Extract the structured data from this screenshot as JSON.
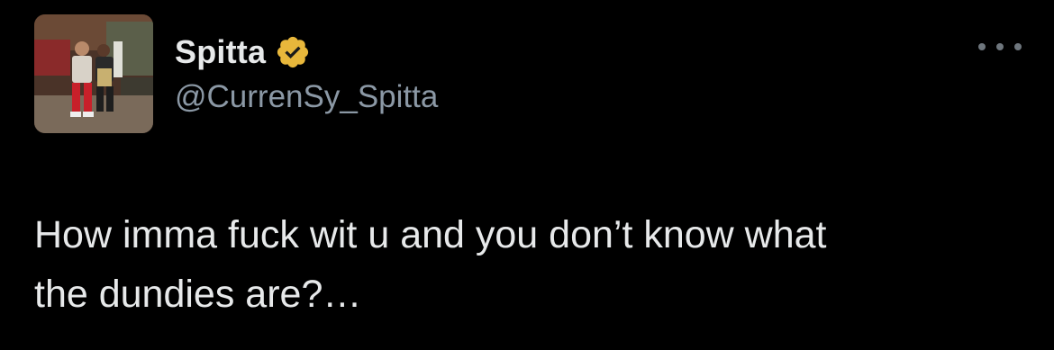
{
  "author": {
    "display_name": "Spitta",
    "handle": "@CurrenSy_Spitta",
    "verified_badge_icon": "verified-badge-icon",
    "avatar_icon": "profile-photo"
  },
  "menu": {
    "more_icon": "more-horizontal-icon"
  },
  "tweet": {
    "text_line_1": "How imma fuck wit u and you don’t know what",
    "text_line_2": "the dundies are?…"
  },
  "colors": {
    "background": "#000000",
    "primary_text": "#e7e9ea",
    "secondary_text": "#8b98a5",
    "verified_gold": "#e8b73b"
  }
}
